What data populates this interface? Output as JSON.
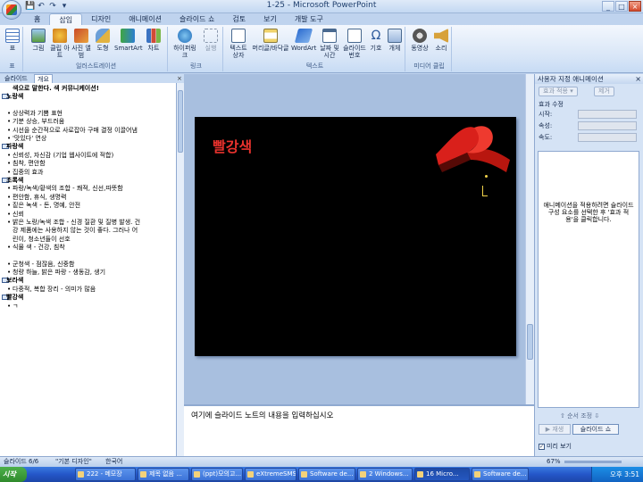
{
  "window": {
    "title": "1-25 - Microsoft PowerPoint",
    "controls": [
      "_",
      "□",
      "×"
    ]
  },
  "quick_access": [
    "💾",
    "↶",
    "↷",
    "▾"
  ],
  "ribbon": {
    "tabs": [
      "홈",
      "삽입",
      "디자인",
      "애니메이션",
      "슬라이드 쇼",
      "검토",
      "보기",
      "개발 도구"
    ],
    "active_tab": "삽입",
    "groups": [
      {
        "label": "표",
        "buttons": [
          "표"
        ]
      },
      {
        "label": "일러스트레이션",
        "buttons": [
          "그림",
          "클립 아트",
          "사진 앨범",
          "도형",
          "SmartArt",
          "차트"
        ]
      },
      {
        "label": "링크",
        "buttons": [
          "하이퍼링크",
          "실행"
        ]
      },
      {
        "label": "텍스트",
        "buttons": [
          "텍스트 상자",
          "머리글/바닥글",
          "WordArt",
          "날짜 및 시간",
          "슬라이드 번호",
          "기호",
          "개체"
        ]
      },
      {
        "label": "미디어 클립",
        "buttons": [
          "동영상",
          "소리"
        ]
      }
    ]
  },
  "outline_pane": {
    "tabs": [
      "슬라이드",
      "개요"
    ],
    "active_tab": "개요",
    "close": "×",
    "lines": [
      {
        "kind": "title",
        "text": "색으로 말한다. 색 커뮤니케이션!"
      },
      {
        "kind": "slide-title",
        "text": "노랑색"
      },
      {
        "kind": "blank",
        "text": ""
      },
      {
        "kind": "bullet",
        "text": "상상력과 기쁨 표현"
      },
      {
        "kind": "bullet",
        "text": "기분 상승, 부드러움"
      },
      {
        "kind": "bullet",
        "text": "시선을 순간적으로 사로잡아 구매 결정 이끌어냄"
      },
      {
        "kind": "bullet",
        "text": "'맛있다' 연상"
      },
      {
        "kind": "slide-title",
        "text": "파랑색"
      },
      {
        "kind": "bullet",
        "text": "신뢰성, 자신감 (기업 웹사이트에 적합)"
      },
      {
        "kind": "bullet",
        "text": "침착, 편안함"
      },
      {
        "kind": "bullet",
        "text": "집중의 효과"
      },
      {
        "kind": "slide-title",
        "text": "초록색"
      },
      {
        "kind": "bullet",
        "text": "파랑/녹색/황색의 조합 - 쾌적, 신선,따뜻함"
      },
      {
        "kind": "bullet",
        "text": "편안함, 휴식, 생명력"
      },
      {
        "kind": "bullet",
        "text": "짙은 녹색 - 돈, 명예, 안전"
      },
      {
        "kind": "bullet",
        "text": "신뢰"
      },
      {
        "kind": "bullet",
        "text": "밝은 노랑/녹색 조합 - 신경 질환 및 질병 발생. 건"
      },
      {
        "kind": "cont",
        "text": "강 제품에는 사용하지 않는 것이 좋다. 그러나 어"
      },
      {
        "kind": "cont",
        "text": "린이, 청소년들이 선호"
      },
      {
        "kind": "bullet",
        "text": "식물 색 - 건강, 침착"
      },
      {
        "kind": "blank",
        "text": ""
      },
      {
        "kind": "bullet",
        "text": "군청색 - 점잖음, 신중함"
      },
      {
        "kind": "bullet",
        "text": "청량 하늘, 밝은 파랑 - 생동감, 생기"
      },
      {
        "kind": "slide-title",
        "text": "보라색"
      },
      {
        "kind": "bullet",
        "text": "다중적, 복합 장리 - 의미가 많음"
      },
      {
        "kind": "slide-title",
        "text": "빨강색"
      },
      {
        "kind": "bullet",
        "text": "ㄱ"
      }
    ]
  },
  "slide": {
    "title": "빨강색"
  },
  "notes": {
    "placeholder": "여기에 슬라이드 노트의 내용을 입력하십시오"
  },
  "task_pane": {
    "title": "사용자 지정 애니메이션",
    "close": "×",
    "add_effect": "효과 적용 ▾",
    "remove": "제거",
    "section": "효과 수정",
    "fields": [
      "시작:",
      "속성:",
      "속도:"
    ],
    "hint": "애니메이션을 적용하려면 슬라이드 구성 요소를 선택한 후 '효과 적용'을 클릭합니다.",
    "reorder": "순서 조정",
    "play": "▶ 재생",
    "slideshow": "슬라이드 쇼",
    "autopreview": "미리 보기",
    "autopreview_checked": "✓"
  },
  "status_bar": {
    "slide_counter": "슬라이드 6/6",
    "theme": "\"기본 디자인\"",
    "language": "한국어",
    "zoom": "67%"
  },
  "taskbar": {
    "start": "시작",
    "tasks": [
      "222 - 메모장",
      "제목 없음 ...",
      "(ppt)모의고...",
      "eXtremeSMS",
      "Software de...",
      "2 Windows...",
      "16 Micro...",
      "Software de..."
    ],
    "active_task": 6,
    "clock": "오후 3:51"
  },
  "colors": {
    "slide_background": "#000000",
    "slide_title": "#e8322d",
    "ribbon_red": "#d9201b"
  }
}
